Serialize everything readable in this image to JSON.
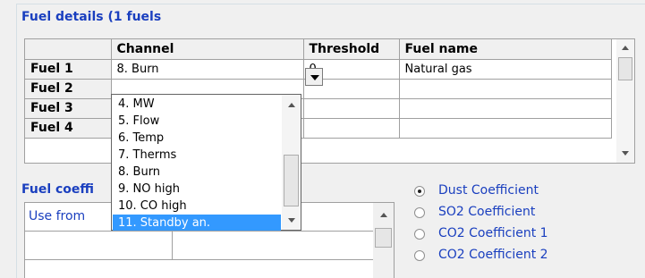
{
  "fuel_details": {
    "title": "Fuel details (1 fuels",
    "columns": [
      "",
      "Channel",
      "Threshold",
      "Fuel name"
    ],
    "rows": [
      {
        "label": "Fuel 1",
        "channel": "8. Burn",
        "threshold": "0",
        "fuel_name": "Natural gas"
      },
      {
        "label": "Fuel 2",
        "channel": "",
        "threshold": "",
        "fuel_name": ""
      },
      {
        "label": "Fuel 3",
        "channel": "",
        "threshold": "",
        "fuel_name": ""
      },
      {
        "label": "Fuel 4",
        "channel": "",
        "threshold": "",
        "fuel_name": ""
      }
    ]
  },
  "channel_dropdown": {
    "options": [
      "4. MW",
      "5. Flow",
      "6. Temp",
      "7. Therms",
      "8. Burn",
      "9. NO high",
      "10. CO high",
      "11. Standby an."
    ],
    "highlighted": "11. Standby an."
  },
  "coefficients": {
    "title": "Fuel coeffi",
    "column_header": "Use from"
  },
  "coefficient_type": {
    "selected": "Dust Coefficient",
    "options": [
      "Dust Coefficient",
      "SO2 Coefficient",
      "CO2 Coefficient 1",
      "CO2 Coefficient 2"
    ]
  },
  "colors": {
    "accent_text": "#1a3fbf",
    "selection": "#3399ff"
  }
}
